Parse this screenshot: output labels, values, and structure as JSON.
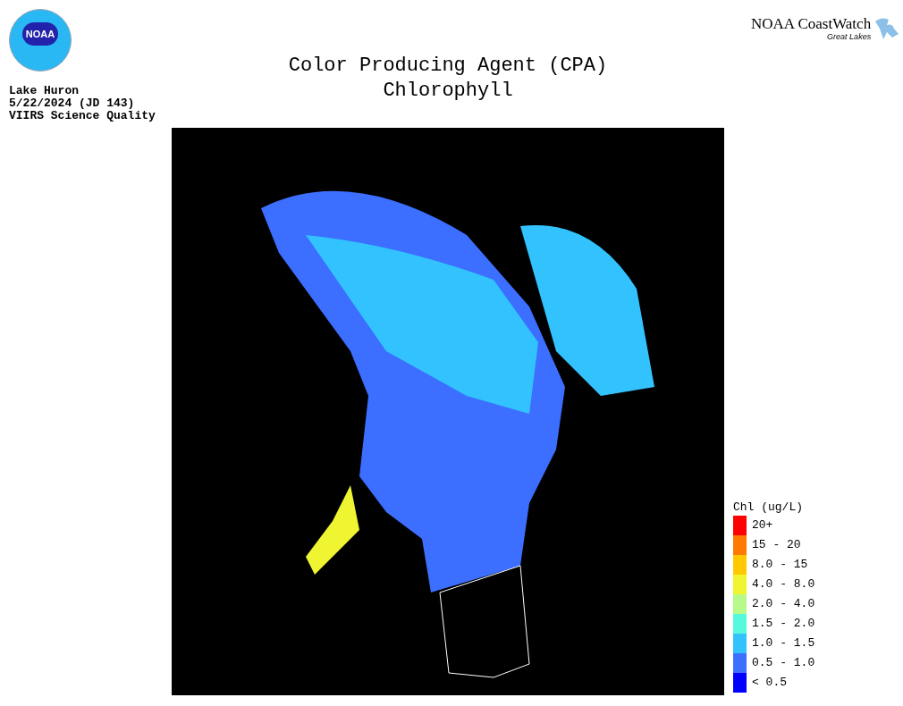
{
  "logo": {
    "text": "NOAA"
  },
  "brand": {
    "name": "NOAA CoastWatch",
    "subtitle": "Great Lakes"
  },
  "title": [
    "Color Producing Agent (CPA)",
    "Chlorophyll"
  ],
  "info": [
    "Lake Huron",
    "5/22/2024 (JD 143)",
    "VIIRS Science Quality"
  ],
  "legend": {
    "title": "Chl (ug/L)",
    "items": [
      {
        "label": "20+",
        "color": "#ff0000"
      },
      {
        "label": "15 - 20",
        "color": "#ff7800"
      },
      {
        "label": "8.0 - 15",
        "color": "#ffc800"
      },
      {
        "label": "4.0 - 8.0",
        "color": "#f0f531"
      },
      {
        "label": "2.0 - 4.0",
        "color": "#b8fa8a"
      },
      {
        "label": "1.5 - 2.0",
        "color": "#55fadc"
      },
      {
        "label": "1.0 - 1.5",
        "color": "#32c3ff"
      },
      {
        "label": "0.5 - 1.0",
        "color": "#3c6eff"
      },
      {
        "label": "< 0.5",
        "color": "#0000ff"
      }
    ]
  }
}
